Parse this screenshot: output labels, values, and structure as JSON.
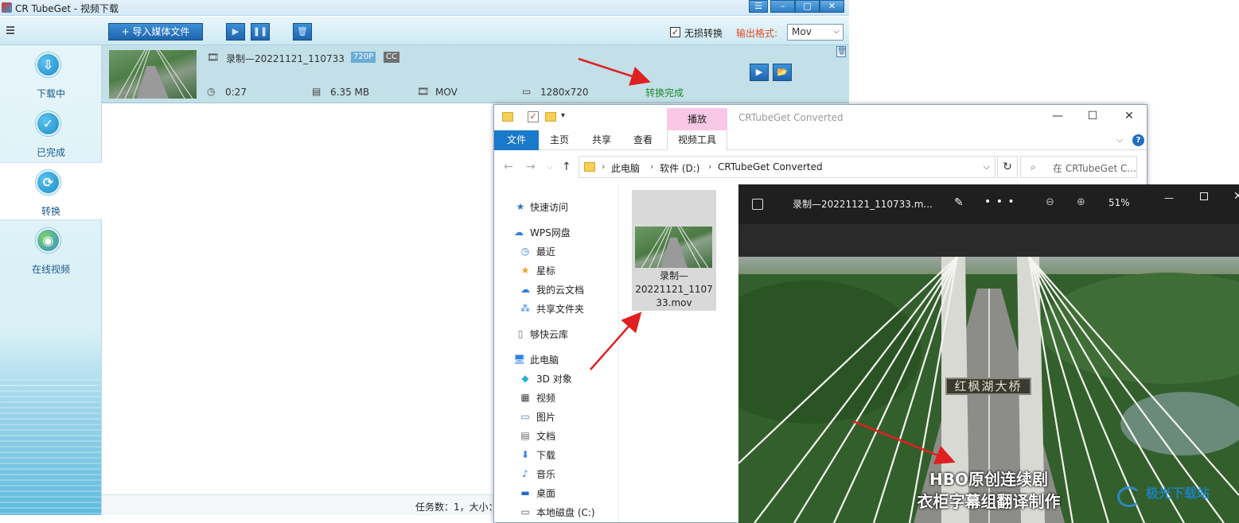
{
  "crtubeget": {
    "title": "CR TubeGet - 视频下载",
    "window_controls": [
      "☰",
      "–",
      "□",
      "✕"
    ],
    "toolbar": {
      "import_label": "+ 导入媒体文件",
      "lossless_label": "无损转换",
      "lossless_checked": true,
      "output_format_label": "输出格式:",
      "output_format_value": "Mov"
    },
    "sidebar": [
      {
        "label": "下载中",
        "icon": "download-icon",
        "glyph": "⇩"
      },
      {
        "label": "已完成",
        "icon": "check-icon",
        "glyph": "✓"
      },
      {
        "label": "转换",
        "icon": "convert-icon",
        "glyph": "⟳"
      },
      {
        "label": "在线视频",
        "icon": "globe-icon",
        "glyph": "◉"
      }
    ],
    "task": {
      "filename": "录制—20221121_110733",
      "badge_res": "720P",
      "badge_cc": "CC",
      "duration": "0:27",
      "size": "6.35 MB",
      "format": "MOV",
      "resolution": "1280x720",
      "status": "转换完成"
    },
    "statusbar": "任务数：1，大小："
  },
  "explorer": {
    "context_tab": "播放",
    "window_title": "CRTubeGet Converted",
    "tabs": {
      "file": "文件",
      "home": "主页",
      "share": "共享",
      "view": "查看",
      "video_tools": "视频工具"
    },
    "breadcrumb": [
      "此电脑",
      "软件 (D:)",
      "CRTubeGet Converted"
    ],
    "search_placeholder": "在 CRTubeGet C...",
    "nav": [
      {
        "label": "快速访问",
        "icon": "star-pin-icon"
      },
      {
        "label": "WPS网盘",
        "icon": "cloud-icon"
      },
      {
        "label": "最近",
        "icon": "clock-icon"
      },
      {
        "label": "星标",
        "icon": "star-icon"
      },
      {
        "label": "我的云文档",
        "icon": "cloud-doc-icon"
      },
      {
        "label": "共享文件夹",
        "icon": "share-folder-icon"
      },
      {
        "label": "够快云库",
        "icon": "file-icon"
      },
      {
        "label": "此电脑",
        "icon": "computer-icon"
      },
      {
        "label": "3D 对象",
        "icon": "cube-icon"
      },
      {
        "label": "视频",
        "icon": "video-icon"
      },
      {
        "label": "图片",
        "icon": "picture-icon"
      },
      {
        "label": "文档",
        "icon": "document-icon"
      },
      {
        "label": "下载",
        "icon": "download-arrow-icon"
      },
      {
        "label": "音乐",
        "icon": "music-icon"
      },
      {
        "label": "桌面",
        "icon": "desktop-icon"
      },
      {
        "label": "本地磁盘 (C:)",
        "icon": "drive-icon"
      }
    ],
    "file": {
      "name_line1": "录制—",
      "name_line2": "20221121_1107",
      "name_line3": "33.mov"
    }
  },
  "viewer": {
    "title": "录制—20221121_110733.m...",
    "zoom": "51%",
    "sign": "红枫湖大桥",
    "subtitle_line1": "HBO原创连续剧",
    "subtitle_line2": "衣柜字幕组翻译制作"
  },
  "watermark": "极光下载站",
  "colors": {
    "accent_blue": "#1979ca",
    "status_green": "#1e8a2a",
    "annotation_red": "#e02020",
    "output_format_orange": "#e24a1c"
  }
}
